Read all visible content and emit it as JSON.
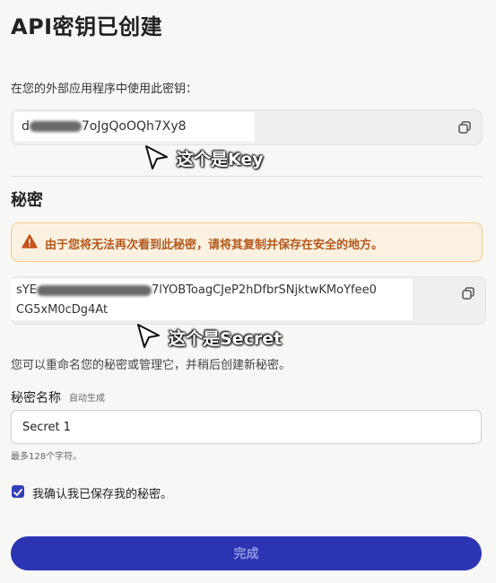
{
  "dialog": {
    "title": "API密钥已创建",
    "intro": "在您的外部应用程序中使用此密钥：",
    "key": {
      "prefix": "d",
      "suffix": "7oJgQoOQh7Xy8"
    },
    "key_annotation": "这个是Key",
    "secret_section": "秘密",
    "warning": "由于您将无法再次看到此秘密，请将其复制并保存在安全的地方。",
    "secret": {
      "prefix": "sYE",
      "line1_suffix": "7lYOBToagCJeP2hDfbrSNjktwKMoYfee0",
      "line2": "CG5xM0cDg4At"
    },
    "secret_annotation": "这个是Secret",
    "description": "您可以重命名您的秘密或管理它，并稍后创建新秘密。",
    "name_field": {
      "label": "秘密名称",
      "auto_label": "自动生成",
      "value": "Secret 1",
      "hint": "最多128个字符。"
    },
    "confirm": {
      "label": "我确认我已保存我的秘密。",
      "checked": true
    },
    "done_label": "完成"
  },
  "colors": {
    "accent": "#2b35b3",
    "warning_text": "#b4591c",
    "warning_bg": "#fbf1e0"
  },
  "icons": {
    "copy": "copy-icon",
    "warning": "warning-icon",
    "check": "check-icon",
    "cursor": "cursor-icon"
  }
}
